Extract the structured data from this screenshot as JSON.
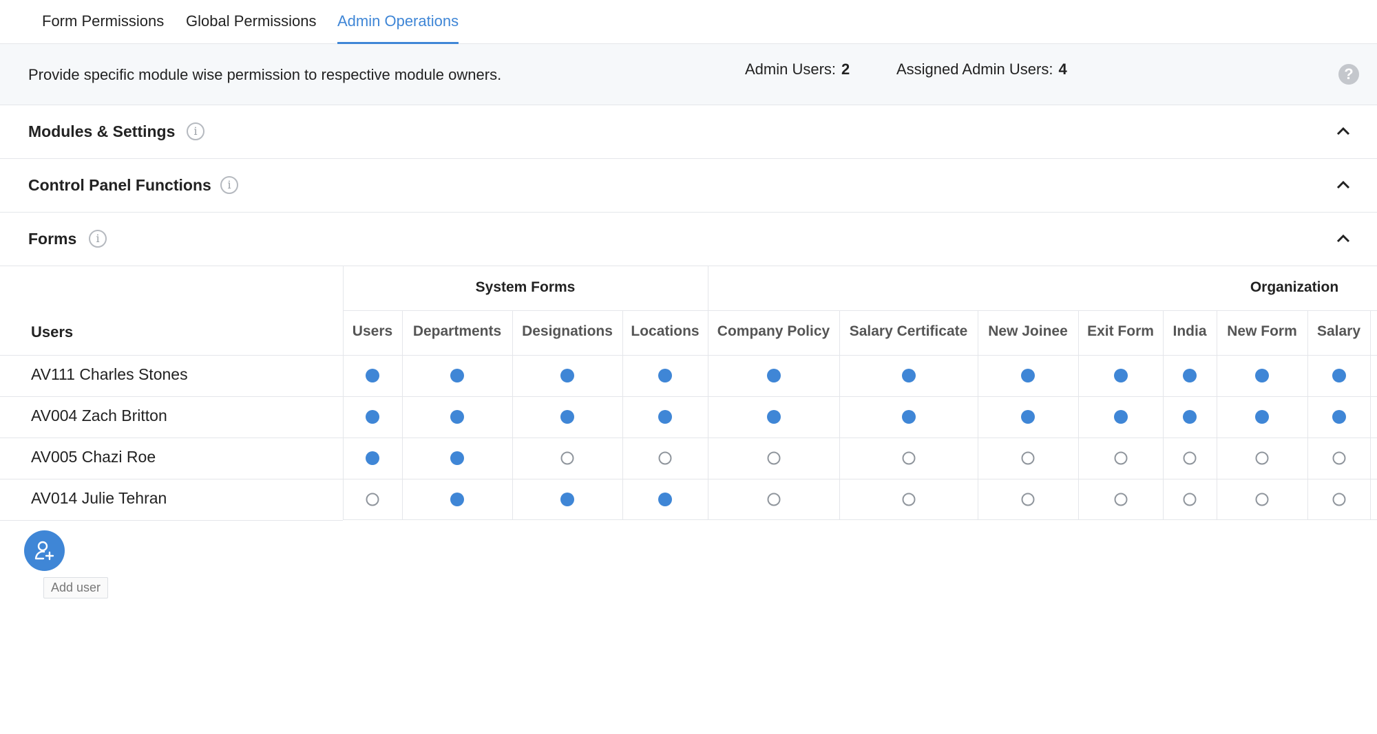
{
  "tabs": [
    {
      "label": "Form Permissions",
      "active": false
    },
    {
      "label": "Global Permissions",
      "active": false
    },
    {
      "label": "Admin Operations",
      "active": true
    }
  ],
  "info": {
    "description": "Provide specific module wise permission to respective module owners.",
    "admin_users_label": "Admin Users:",
    "admin_users_value": "2",
    "assigned_label": "Assigned Admin Users:",
    "assigned_value": "4",
    "help_icon": "question-icon"
  },
  "sections": [
    {
      "title": "Modules & Settings",
      "icon": "info-icon",
      "expanded": true
    },
    {
      "title": "Control Panel Functions",
      "icon": "info-icon",
      "expanded": true
    },
    {
      "title": "Forms",
      "icon": "info-icon",
      "expanded": true
    }
  ],
  "table": {
    "users_header": "Users",
    "groups": [
      {
        "label": "System Forms"
      },
      {
        "label": "Organization"
      }
    ],
    "columns": [
      "Users",
      "Departments",
      "Designations",
      "Locations",
      "Company Policy",
      "Salary Certificate",
      "New Joinee",
      "Exit Form",
      "India",
      "New Form",
      "Salary"
    ],
    "rows": [
      {
        "user": "AV111 Charles Stones",
        "perms": [
          1,
          1,
          1,
          1,
          1,
          1,
          1,
          1,
          1,
          1,
          1
        ]
      },
      {
        "user": "AV004 Zach Britton",
        "perms": [
          1,
          1,
          1,
          1,
          1,
          1,
          1,
          1,
          1,
          1,
          1
        ]
      },
      {
        "user": "AV005 Chazi Roe",
        "perms": [
          1,
          1,
          0,
          0,
          0,
          0,
          0,
          0,
          0,
          0,
          0
        ]
      },
      {
        "user": "AV014 Julie Tehran",
        "perms": [
          0,
          1,
          1,
          1,
          0,
          0,
          0,
          0,
          0,
          0,
          0
        ]
      }
    ]
  },
  "add_user": {
    "label": "Add user",
    "icon": "add-user-icon"
  },
  "colors": {
    "accent": "#3f86d6",
    "border": "#e4e6ea",
    "bar_bg": "#f6f8fa"
  }
}
